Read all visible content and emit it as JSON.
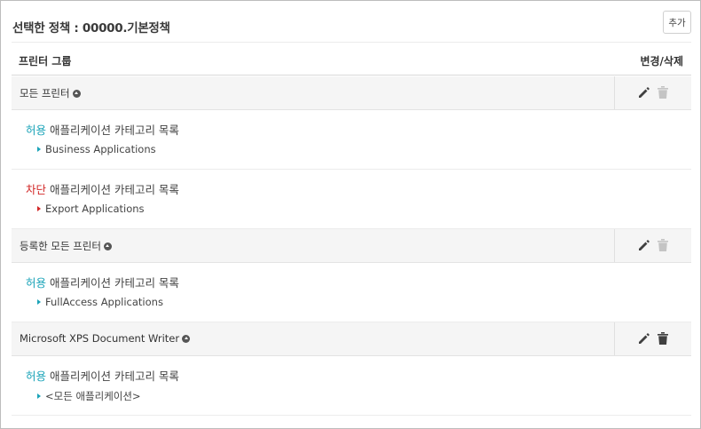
{
  "header": {
    "title": "선택한 정책 : 00000.기본정책",
    "add_button": "추가"
  },
  "columns": {
    "group": "프린터 그룹",
    "actions": "변경/삭제"
  },
  "groups": [
    {
      "name": "모든 프린터",
      "delete_enabled": false,
      "rules": [
        {
          "type_label": "허용",
          "type": "allow",
          "title_suffix": " 애플리케이션 카테고리 목록",
          "items": [
            "Business Applications"
          ]
        },
        {
          "type_label": "차단",
          "type": "deny",
          "title_suffix": " 애플리케이션 카테고리 목록",
          "items": [
            "Export Applications"
          ]
        }
      ]
    },
    {
      "name": "등록한 모든 프린터",
      "delete_enabled": false,
      "rules": [
        {
          "type_label": "허용",
          "type": "allow",
          "title_suffix": " 애플리케이션 카테고리 목록",
          "items": [
            "FullAccess Applications"
          ]
        }
      ]
    },
    {
      "name": "Microsoft XPS Document Writer",
      "delete_enabled": true,
      "rules": [
        {
          "type_label": "허용",
          "type": "allow",
          "title_suffix": " 애플리케이션 카테고리 목록",
          "items": [
            "<모든 애플리케이션>"
          ]
        }
      ]
    }
  ],
  "icons": {
    "edit": "pencil-icon",
    "delete": "trash-icon",
    "collapse": "circle-up-icon"
  },
  "colors": {
    "allow": "#1aa3b8",
    "deny": "#d22727",
    "group_bg": "#f5f5f5"
  }
}
